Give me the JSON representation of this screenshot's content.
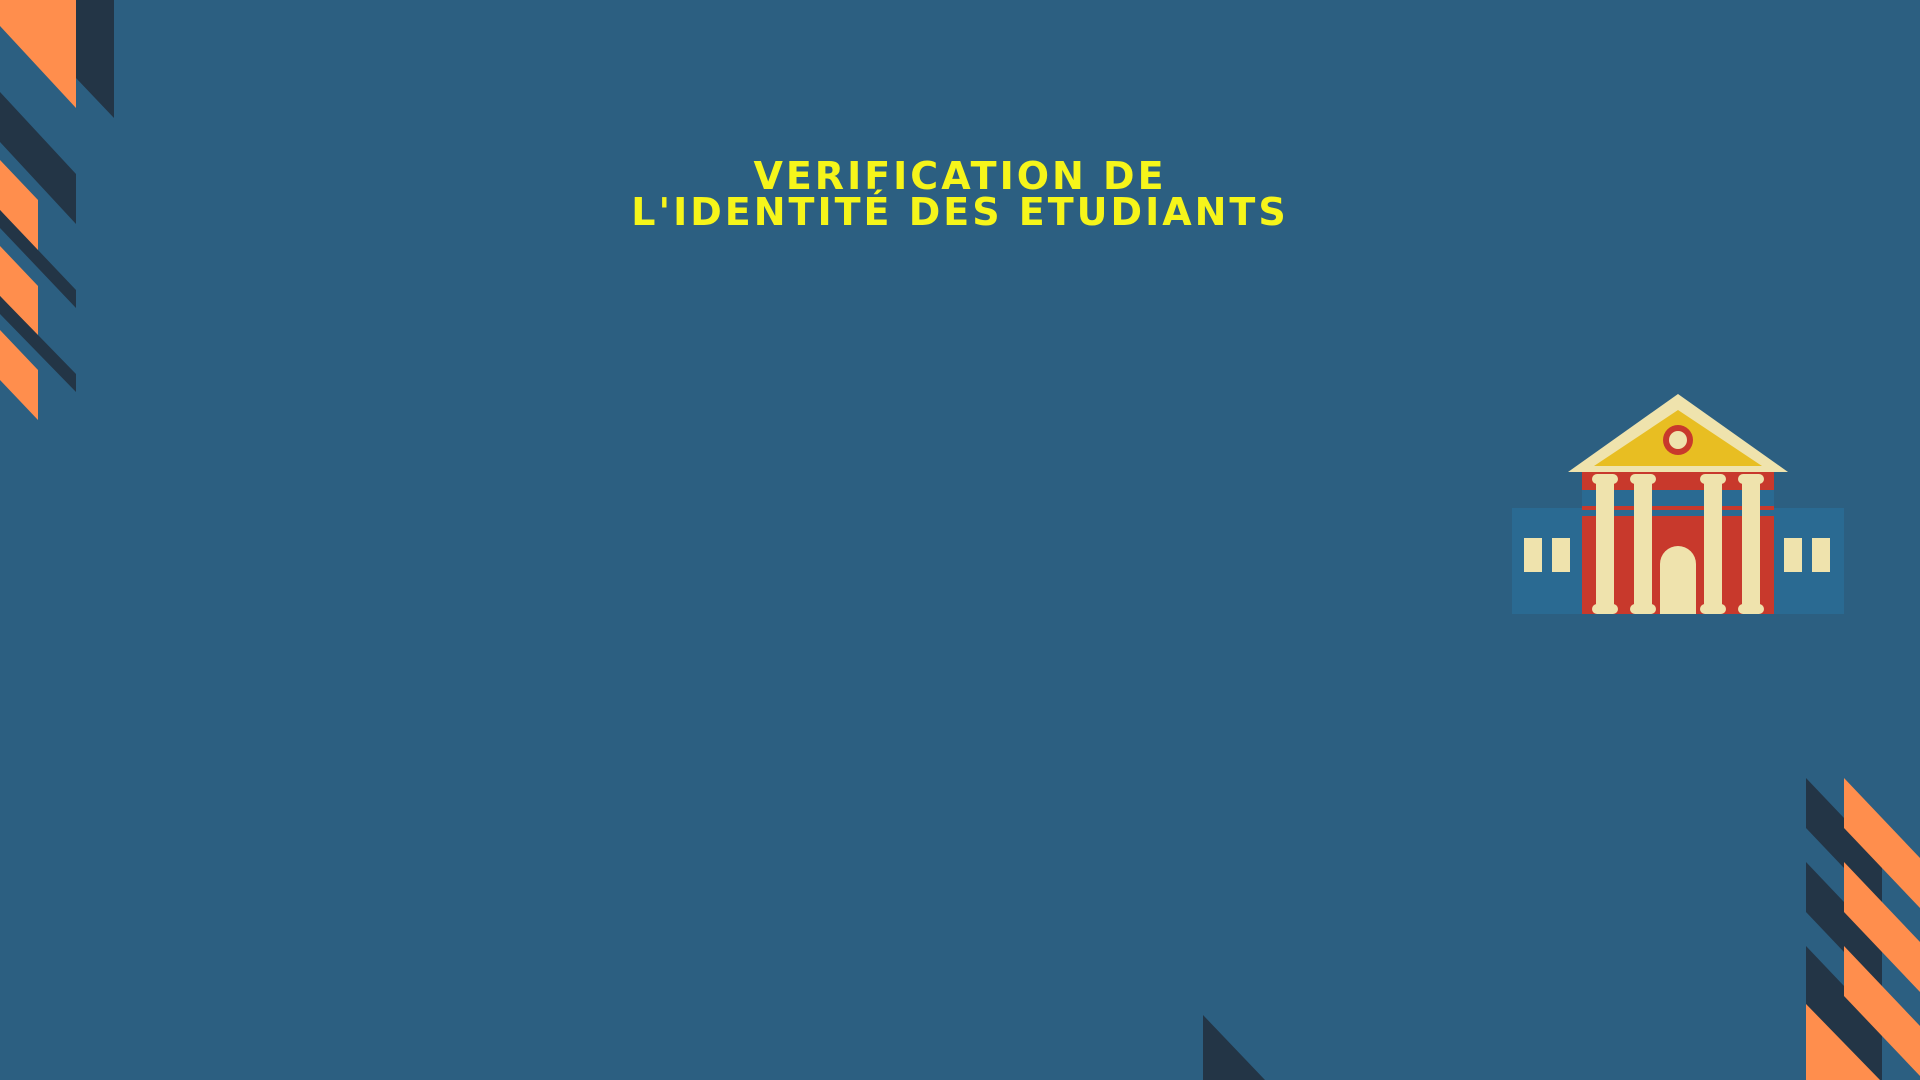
{
  "slide": {
    "title_line1": "VERIFICATION DE",
    "title_line2": "L'IDENTITÉ DES ETUDIANTS"
  },
  "colors": {
    "background": "#2c5f81",
    "title": "#f6f51a",
    "accent_orange": "#ff8e4d",
    "accent_dark": "#233546",
    "building_red": "#c8392c",
    "building_cream": "#efe3ad",
    "building_gold": "#e8be22",
    "building_wing": "#2a6a92"
  },
  "icons": {
    "illustration": "university-building-icon"
  }
}
